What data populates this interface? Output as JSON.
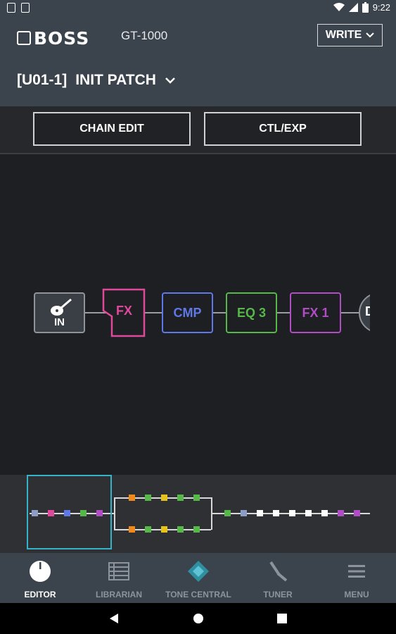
{
  "status": {
    "time": "9:22"
  },
  "header": {
    "brand": "BOSS",
    "model": "GT-1000",
    "write_label": "WRITE",
    "patch_id": "[U01-1]",
    "patch_name": "INIT PATCH"
  },
  "toolbar": {
    "chain_edit": "CHAIN EDIT",
    "ctl_exp": "CTL/EXP"
  },
  "chain": {
    "blocks": [
      {
        "label": "IN",
        "color": "#8e949a"
      },
      {
        "label": "FX",
        "color": "#e0489b"
      },
      {
        "label": "CMP",
        "color": "#5f78e8"
      },
      {
        "label": "EQ 3",
        "color": "#56b848"
      },
      {
        "label": "FX 1",
        "color": "#b04cc4"
      },
      {
        "label": "D",
        "color": "#8e949a"
      }
    ]
  },
  "nav": {
    "items": [
      {
        "label": "EDITOR",
        "icon": "knob-icon"
      },
      {
        "label": "LIBRARIAN",
        "icon": "librarian-icon"
      },
      {
        "label": "TONE CENTRAL",
        "icon": "tone-central-icon"
      },
      {
        "label": "TUNER",
        "icon": "tuner-icon"
      },
      {
        "label": "MENU",
        "icon": "menu-icon"
      }
    ]
  },
  "colors": {
    "accent": "#35b3c9",
    "bar": "#3b434c"
  }
}
